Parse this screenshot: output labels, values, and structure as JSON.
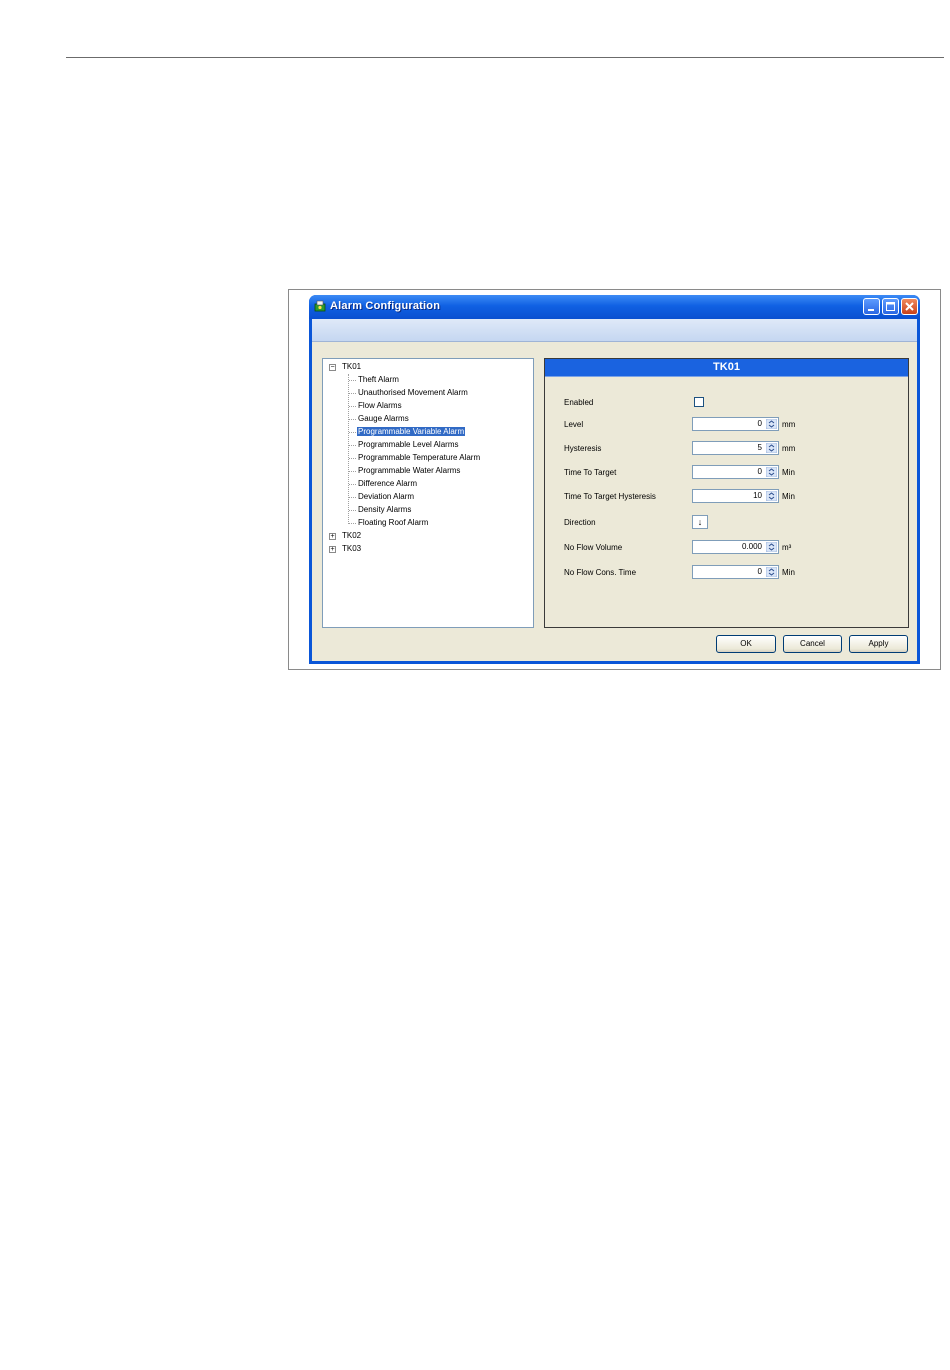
{
  "window": {
    "title": "Alarm Configuration"
  },
  "tree": {
    "nodes": [
      {
        "label": "TK01",
        "expander": "⊟"
      },
      {
        "label": "Theft Alarm"
      },
      {
        "label": "Unauthorised Movement Alarm"
      },
      {
        "label": "Flow Alarms"
      },
      {
        "label": "Gauge Alarms"
      },
      {
        "label": "Programmable Variable Alarm",
        "selected": true
      },
      {
        "label": "Programmable Level Alarms"
      },
      {
        "label": "Programmable Temperature Alarm"
      },
      {
        "label": "Programmable Water Alarms"
      },
      {
        "label": "Difference Alarm"
      },
      {
        "label": "Deviation Alarm"
      },
      {
        "label": "Density Alarms"
      },
      {
        "label": "Floating Roof Alarm"
      },
      {
        "label": "TK02",
        "expander": "⊞"
      },
      {
        "label": "TK03",
        "expander": "⊞"
      }
    ]
  },
  "panel": {
    "title": "TK01",
    "fields": {
      "enabled": {
        "label": "Enabled",
        "checked": false
      },
      "level": {
        "label": "Level",
        "value": "0",
        "unit": "mm"
      },
      "hysteresis": {
        "label": "Hysteresis",
        "value": "5",
        "unit": "mm"
      },
      "time_to_target": {
        "label": "Time To Target",
        "value": "0",
        "unit": "Min"
      },
      "time_to_target_hysteresis": {
        "label": "Time To Target Hysteresis",
        "value": "10",
        "unit": "Min"
      },
      "direction": {
        "label": "Direction",
        "value": "↓"
      },
      "no_flow_volume": {
        "label": "No Flow Volume",
        "value": "0.000",
        "unit": "m³"
      },
      "no_flow_cons_time": {
        "label": "No Flow Cons. Time",
        "value": "0",
        "unit": "Min"
      }
    }
  },
  "buttons": {
    "ok": "OK",
    "cancel": "Cancel",
    "apply": "Apply"
  },
  "colors": {
    "titlebar": "#0a56d8",
    "panel_header": "#1a63e0",
    "selection": "#316ac5",
    "dialog_bg": "#ece9d8"
  }
}
